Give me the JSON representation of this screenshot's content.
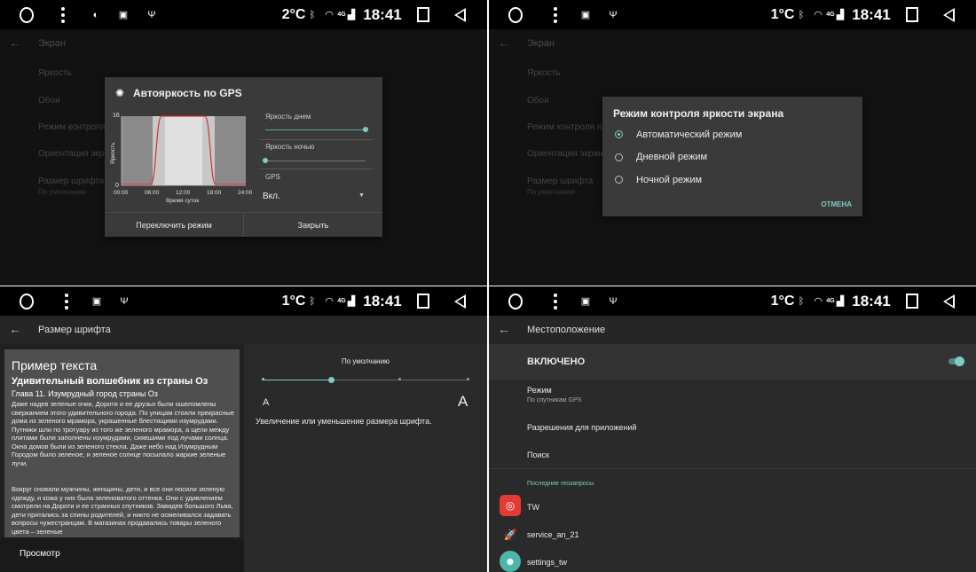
{
  "colors": {
    "accent": "#80cbc4",
    "background": "#212121",
    "dialog": "#3a3a3a",
    "statusbar": "#000000"
  },
  "status": {
    "p1": {
      "temp": "2°C",
      "net": "4G",
      "time": "18:41"
    },
    "p2": {
      "temp": "1°C",
      "net": "4G",
      "time": "18:41"
    },
    "p3": {
      "temp": "1°C",
      "net": "4G",
      "time": "18:41"
    },
    "p4": {
      "temp": "1°C",
      "net": "4G",
      "time": "18:41"
    }
  },
  "screen_settings": {
    "title": "Экран",
    "items": [
      "Яркость",
      "Обои",
      "Режим контроля",
      "Ориентация экра",
      "Размер шрифта"
    ],
    "font_size_value": "По умолчанию"
  },
  "screen_settings_2": {
    "title": "Экран",
    "items": [
      "Яркость",
      "Обои",
      "Режим контроля яр",
      "Ориентация экрана",
      "Размер шрифта"
    ],
    "font_size_value": "По умолчанию"
  },
  "gps_dialog": {
    "title": "Автояркость по GPS",
    "chart_y_label": "Яркость",
    "chart_y_max": "16",
    "chart_y_min": "0",
    "chart_x_ticks": [
      "00:00",
      "06:00",
      "12:00",
      "18:00",
      "24:00"
    ],
    "chart_x_label": "Время суток",
    "day_brightness_label": "Яркость днем",
    "night_brightness_label": "Яркость ночью",
    "day_brightness_level": 1.0,
    "night_brightness_level": 0.0,
    "gps_label": "GPS",
    "gps_value": "Вкл.",
    "switch_mode_button": "Переключить режим",
    "close_button": "Закрыть"
  },
  "mode_dialog": {
    "title": "Режим контроля яркости экрана",
    "options": [
      "Автоматический режим",
      "Дневной режим",
      "Ночной режим"
    ],
    "selected": 0,
    "cancel": "ОТМЕНА"
  },
  "font_size": {
    "title": "Размер шрифта",
    "preview_heading": "Пример текста",
    "book_title": "Удивительный волшебник из страны Оз",
    "chapter": "Глава 11. Изумрудный город страны Оз",
    "paragraph1": "Даже надев зеленые очки, Дороти и ее друзья были ошеломлены сверканием этого удивительного города. По улицам стояли прекрасные дома из зеленого мрамора, украшенные блестящими изумрудами. Путники шли по тротуару из того же зеленого мрамора, а щели между плитами были заполнены изумрудами, сиявшими под лучами солнца. Окна домов были из зеленого стекла. Даже небо над Изумрудным Городом было зеленое, и зеленое солнце посылало жаркие зеленые лучи.",
    "paragraph2": "Вокруг сновали мужчины, женщины, дети, и все они носили зеленую одежду, и кожа у них была зеленоватого оттенка. Они с удивлением смотрели на Дороти и ее странных спутников. Завидев большого Льва, дети прятались за спины родителей, и никто не осмеливался задавать вопросы чужестранцам. В магазинах продавались товары зеленого цвета – зеленые",
    "preview_label": "Просмотр",
    "current_label": "По умолчанию",
    "small_a": "A",
    "large_a": "A",
    "description": "Увеличение или уменьшение размера шрифта.",
    "level": 0.333
  },
  "location": {
    "title": "Местоположение",
    "enabled_label": "ВКЛЮЧЕНО",
    "mode_label": "Режим",
    "mode_value": "По спутникам GPS",
    "app_permissions": "Разрешения для приложений",
    "search": "Поиск",
    "recent_header": "Последние геозапросы",
    "apps": [
      "TW",
      "service_an_21",
      "settings_tw"
    ]
  }
}
